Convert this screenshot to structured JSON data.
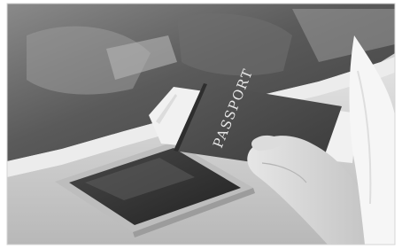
{
  "photo": {
    "palette": {
      "background": "#ffffff",
      "frame_edge": "#d4d4d4",
      "window_glass": "#5d5d5d",
      "window_highlight": "#9a9a9a",
      "counter": "#c9c9c9",
      "counter_edge": "#eeeeee",
      "tablet_body": "#bdbdbd",
      "tablet_screen": "#3a3a3a",
      "passport_cover": "#4a4a4a",
      "ticket_paper": "#f1f1f1",
      "skin": "#d9d9d9",
      "sleeve": "#f6f6f6"
    },
    "passport_cover_text": "PASSPORT"
  }
}
